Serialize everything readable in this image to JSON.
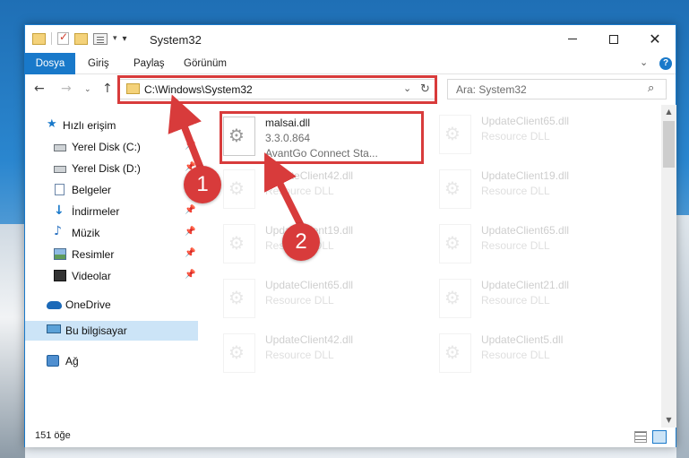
{
  "window": {
    "title": "System32",
    "controls": {
      "minimize": "",
      "maximize": "",
      "close": "✕"
    }
  },
  "ribbon": {
    "tabs": [
      "Dosya",
      "Giriş",
      "Paylaş",
      "Görünüm"
    ],
    "expand_glyph": "⌄",
    "help_glyph": "?"
  },
  "navigation": {
    "back_glyph": "←",
    "forward_glyph": "→",
    "recent_glyph": "⌄",
    "up_glyph": "↑",
    "address": "C:\\Windows\\System32",
    "address_dropdown_glyph": "⌄",
    "refresh_glyph": "↻",
    "search_placeholder": "Ara: System32",
    "search_glyph": "⌕"
  },
  "sidebar": {
    "items": [
      {
        "label": "Hızlı erişim",
        "icon": "star-icon",
        "pinned": false
      },
      {
        "label": "Yerel Disk (C:)",
        "icon": "drive-icon",
        "pinned": true
      },
      {
        "label": "Yerel Disk (D:)",
        "icon": "drive-icon",
        "pinned": true
      },
      {
        "label": "Belgeler",
        "icon": "documents-icon",
        "pinned": true
      },
      {
        "label": "İndirmeler",
        "icon": "downloads-icon",
        "pinned": true
      },
      {
        "label": "Müzik",
        "icon": "music-icon",
        "pinned": true
      },
      {
        "label": "Resimler",
        "icon": "pictures-icon",
        "pinned": true
      },
      {
        "label": "Videolar",
        "icon": "videos-icon",
        "pinned": true
      },
      {
        "label": "OneDrive",
        "icon": "onedrive-icon",
        "pinned": false
      },
      {
        "label": "Bu bilgisayar",
        "icon": "computer-icon",
        "pinned": false,
        "selected": true
      },
      {
        "label": "Ağ",
        "icon": "network-icon",
        "pinned": false
      }
    ],
    "pin_glyph": "📌"
  },
  "files": [
    {
      "name": "malsai.dll",
      "version": "3.3.0.864",
      "description": "AvantGo Connect Sta...",
      "highlighted": true
    },
    {
      "name": "UpdateClient65.dll",
      "description": "Resource DLL"
    },
    {
      "name": "UpdateClient42.dll",
      "description": "Resource DLL"
    },
    {
      "name": "UpdateClient19.dll",
      "description": "Resource DLL"
    },
    {
      "name": "UpdateClient19.dll",
      "description": "Resource DLL"
    },
    {
      "name": "UpdateClient65.dll",
      "description": "Resource DLL"
    },
    {
      "name": "UpdateClient65.dll",
      "description": "Resource DLL"
    },
    {
      "name": "UpdateClient21.dll",
      "description": "Resource DLL"
    },
    {
      "name": "UpdateClient42.dll",
      "description": "Resource DLL"
    },
    {
      "name": "UpdateClient5.dll",
      "description": "Resource DLL"
    }
  ],
  "scrollbar": {
    "up_glyph": "▲",
    "down_glyph": "▼"
  },
  "status": {
    "item_count": "151 öğe"
  },
  "annotations": {
    "callout_1": "1",
    "callout_2": "2",
    "color": "#d83b3b"
  },
  "colors": {
    "accent": "#1979ca",
    "selection": "#cce4f7"
  }
}
